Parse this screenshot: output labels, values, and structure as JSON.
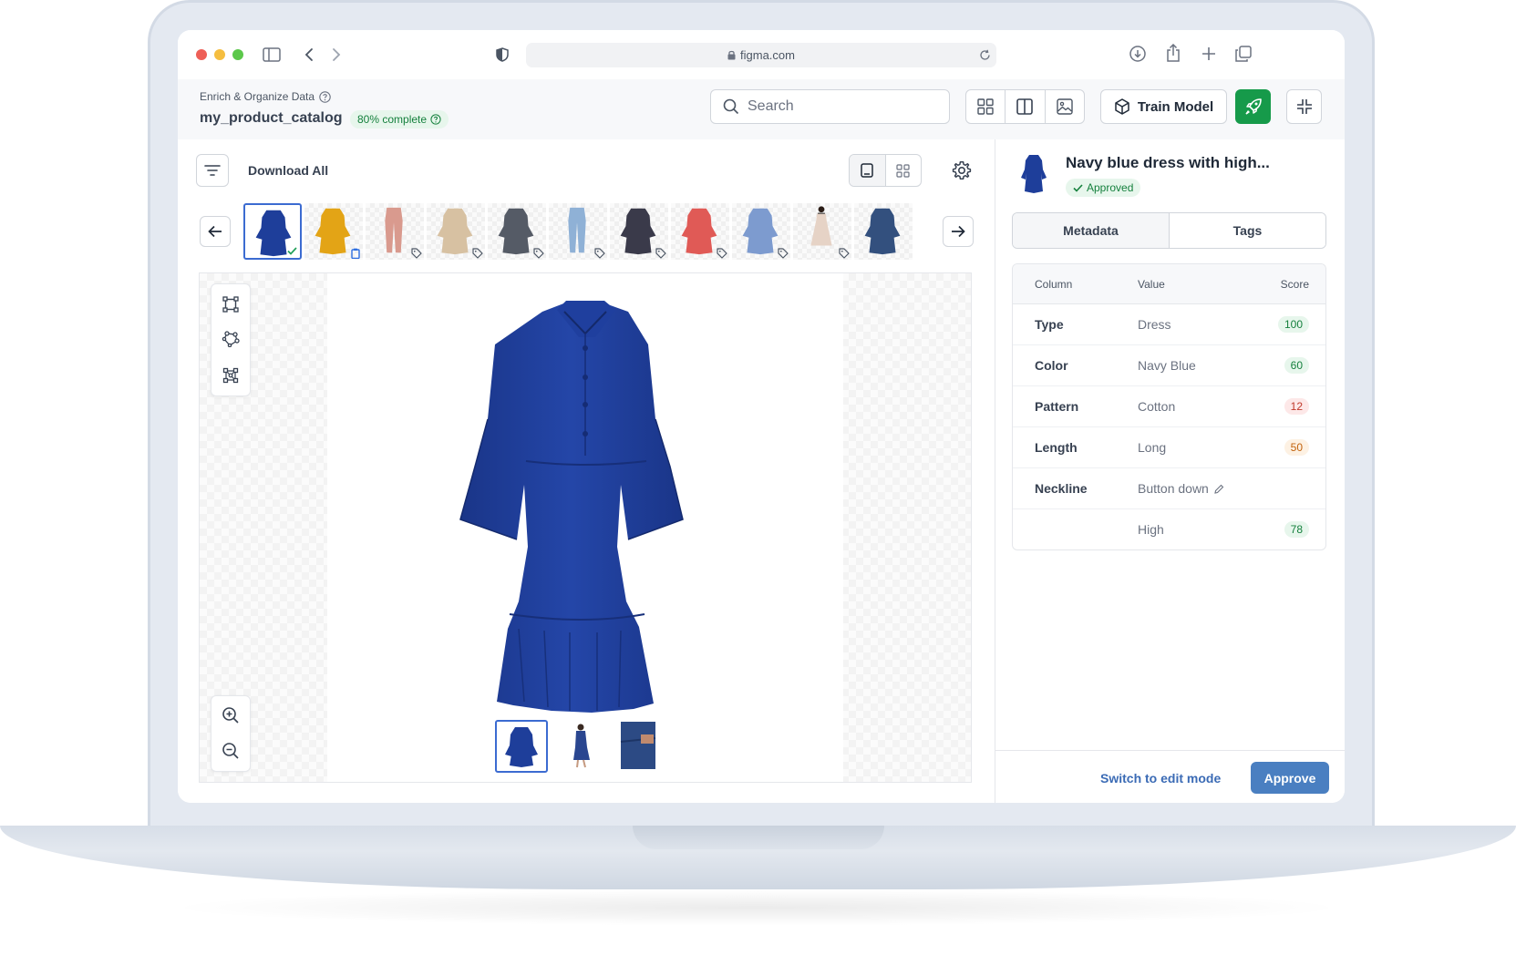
{
  "browser": {
    "url": "figma.com"
  },
  "header": {
    "breadcrumb": "Enrich & Organize Data",
    "catalog_name": "my_product_catalog",
    "progress_label": "80% complete",
    "search_placeholder": "Search",
    "train_label": "Train Model",
    "accent": "#169a4a"
  },
  "toolbar": {
    "download_all": "Download All"
  },
  "thumbnails": [
    {
      "item": "navy-dress",
      "color": "#1e3e9a",
      "status": "approved"
    },
    {
      "item": "yellow-dress",
      "color": "#e3a416",
      "status": "pending"
    },
    {
      "item": "pink-pants",
      "color": "#d99a8e",
      "status": "tag"
    },
    {
      "item": "beige-dress",
      "color": "#d7c1a2",
      "status": "tag"
    },
    {
      "item": "patterned-dress",
      "color": "#555b66",
      "status": "tag"
    },
    {
      "item": "jeans",
      "color": "#8fb1d6",
      "status": "tag"
    },
    {
      "item": "print-dress",
      "color": "#3a3a4a",
      "status": "tag"
    },
    {
      "item": "red-dress",
      "color": "#e05a56",
      "status": "tag"
    },
    {
      "item": "blue-dress",
      "color": "#7d9bcf",
      "status": "tag"
    },
    {
      "item": "skirt",
      "color": "#e6d3c6",
      "status": "tag"
    },
    {
      "item": "denim-dress",
      "color": "#33507e",
      "status": "none"
    }
  ],
  "product": {
    "title": "Navy blue dress with high...",
    "status": "Approved",
    "color": "#1e3e9a"
  },
  "tabs": [
    "Metadata",
    "Tags"
  ],
  "table": {
    "headers": [
      "Column",
      "Value",
      "Score"
    ],
    "rows": [
      {
        "column": "Type",
        "value": "Dress",
        "score": "100",
        "level": "high"
      },
      {
        "column": "Color",
        "value": "Navy Blue",
        "score": "60",
        "level": "high"
      },
      {
        "column": "Pattern",
        "value": "Cotton",
        "score": "12",
        "level": "low"
      },
      {
        "column": "Length",
        "value": "Long",
        "score": "50",
        "level": "mid"
      },
      {
        "column": "Neckline",
        "value": "Button down",
        "score": "",
        "level": "edit"
      },
      {
        "column": "",
        "value": "High",
        "score": "78",
        "level": "high"
      }
    ]
  },
  "footer": {
    "edit_link": "Switch to edit mode",
    "approve_label": "Approve"
  }
}
